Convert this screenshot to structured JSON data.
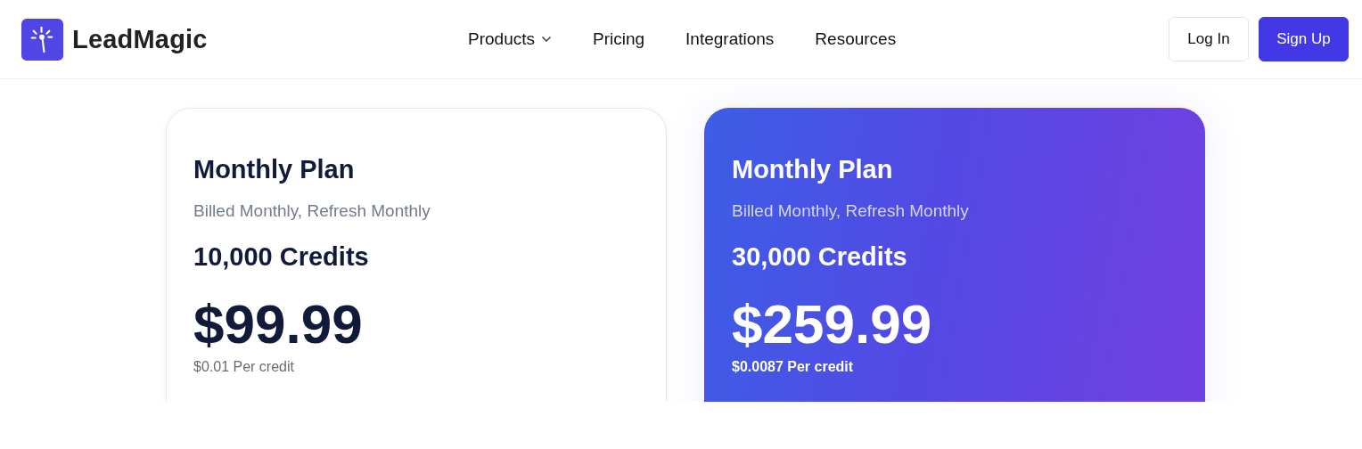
{
  "brand": {
    "name": "LeadMagic"
  },
  "nav": [
    {
      "label": "Products",
      "has_menu": true
    },
    {
      "label": "Pricing",
      "has_menu": false
    },
    {
      "label": "Integrations",
      "has_menu": false
    },
    {
      "label": "Resources",
      "has_menu": false
    }
  ],
  "actions": [
    {
      "label": "Log In",
      "kind": "outline"
    },
    {
      "label": "Sign Up",
      "kind": "primary"
    }
  ],
  "plans": [
    {
      "title": "Monthly Plan",
      "billing": "Billed Monthly, Refresh Monthly",
      "credits": "10,000 Credits",
      "price": "$99.99",
      "per_credit": "$0.01 Per credit",
      "highlighted": false
    },
    {
      "title": "Monthly Plan",
      "billing": "Billed Monthly, Refresh Monthly",
      "credits": "30,000 Credits",
      "price": "$259.99",
      "per_credit": "$0.0087 Per credit",
      "highlighted": true
    }
  ]
}
